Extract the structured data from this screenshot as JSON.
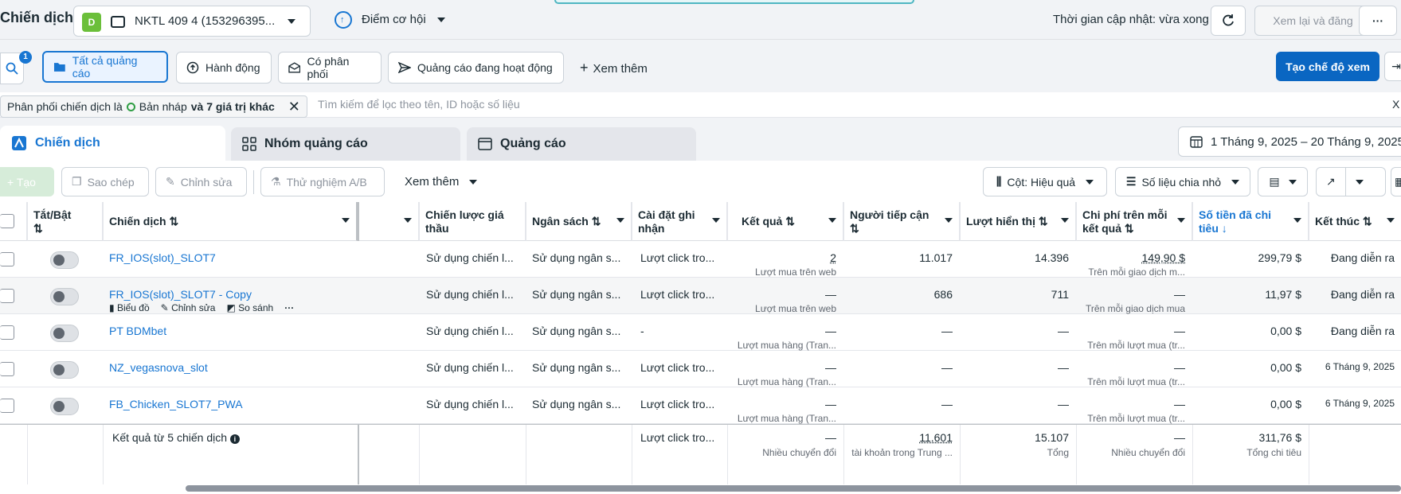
{
  "header": {
    "title": "Chiến dịch",
    "account_initial": "D",
    "account_name": "NKTL 409 4 (153296395...",
    "opportunity": "Điểm cơ hội",
    "update_time": "Thời gian cập nhật: vừa xong",
    "review_publish": "Xem lại và đăng",
    "more": "···"
  },
  "filters": {
    "search_badge": "1",
    "all_ads": "Tất cả quảng cáo",
    "actions": "Hành động",
    "has_delivery": "Có phân phối",
    "active_ads": "Quảng cáo đang hoạt động",
    "see_more": "Xem thêm",
    "create_view": "Tạo chế độ xem",
    "chip_text": "Phân phối chiến dịch là",
    "chip_value": "Bản nháp",
    "chip_more": "và 7 giá trị khác",
    "search_placeholder": "Tìm kiếm để lọc theo tên, ID hoặc số liệu",
    "clear": "X"
  },
  "tabs": {
    "campaigns": "Chiến dịch",
    "adsets": "Nhóm quảng cáo",
    "ads": "Quảng cáo",
    "date_range": "1 Tháng 9, 2025 – 20 Tháng 9, 2025"
  },
  "toolbar": {
    "create": "+ Tạo",
    "copy": "Sao chép",
    "edit": "Chỉnh sửa",
    "ab_test": "Thử nghiệm A/B",
    "more": "Xem thêm",
    "columns": "Cột: Hiệu quả",
    "breakdown": "Số liệu chia nhỏ"
  },
  "columns": {
    "toggle": "Tắt/Bật",
    "campaign": "Chiến dịch",
    "bid_strategy": "Chiến lược giá thầu",
    "budget": "Ngân sách",
    "attribution": "Cài đặt ghi nhận",
    "results": "Kết quả",
    "reach": "Người tiếp cận",
    "impressions": "Lượt hiển thị",
    "cost_per_result": "Chi phí trên mỗi kết quả",
    "amount_spent": "Số tiền đã chi tiêu",
    "ends": "Kết thúc"
  },
  "rows": [
    {
      "name": "FR_IOS(slot)_SLOT7",
      "bid": "Sử dụng chiến l...",
      "budget": "Sử dụng ngân s...",
      "attribution": "Lượt click tro...",
      "results": "2",
      "results_sub": "Lượt mua trên web",
      "reach": "11.017",
      "impressions": "14.396",
      "cpr": "149,90 $",
      "cpr_sub": "Trên mỗi giao dịch m...",
      "spent": "299,79 $",
      "ends": "Đang diễn ra"
    },
    {
      "name": "FR_IOS(slot)_SLOT7 - Copy",
      "bid": "Sử dụng chiến l...",
      "budget": "Sử dụng ngân s...",
      "attribution": "Lượt click tro...",
      "results": "—",
      "results_sub": "Lượt mua trên web",
      "reach": "686",
      "impressions": "711",
      "cpr": "—",
      "cpr_sub": "Trên mỗi giao dịch mua",
      "spent": "11,97 $",
      "ends": "Đang diễn ra",
      "hover_chart": "Biểu đồ",
      "hover_edit": "Chỉnh sửa",
      "hover_compare": "So sánh"
    },
    {
      "name": "PT BDMbet",
      "bid": "Sử dụng chiến l...",
      "budget": "Sử dụng ngân s...",
      "attribution": "-",
      "results": "—",
      "results_sub": "Lượt mua hàng (Tran...",
      "reach": "—",
      "impressions": "—",
      "cpr": "—",
      "cpr_sub": "Trên mỗi lượt mua (tr...",
      "spent": "0,00 $",
      "ends": "Đang diễn ra"
    },
    {
      "name": "NZ_vegasnova_slot",
      "bid": "Sử dụng chiến l...",
      "budget": "Sử dụng ngân s...",
      "attribution": "Lượt click tro...",
      "results": "—",
      "results_sub": "Lượt mua hàng (Tran...",
      "reach": "—",
      "impressions": "—",
      "cpr": "—",
      "cpr_sub": "Trên mỗi lượt mua (tr...",
      "spent": "0,00 $",
      "ends": "6 Tháng 9, 2025"
    },
    {
      "name": "FB_Chicken_SLOT7_PWA",
      "bid": "Sử dụng chiến l...",
      "budget": "Sử dụng ngân s...",
      "attribution": "Lượt click tro...",
      "results": "—",
      "results_sub": "Lượt mua hàng (Tran...",
      "reach": "—",
      "impressions": "—",
      "cpr": "—",
      "cpr_sub": "Trên mỗi lượt mua (tr...",
      "spent": "0,00 $",
      "ends": "6 Tháng 9, 2025"
    }
  ],
  "summary": {
    "label": "Kết quả từ 5 chiến dịch",
    "attribution": "Lượt click tro...",
    "results": "—",
    "results_sub": "Nhiều chuyển đổi",
    "reach": "11.601",
    "reach_sub": "tài khoản trong Trung ...",
    "impressions": "15.107",
    "impressions_sub": "Tổng",
    "cpr": "—",
    "cpr_sub": "Nhiều chuyển đổi",
    "spent": "311,76 $",
    "spent_sub": "Tổng chi tiêu"
  }
}
